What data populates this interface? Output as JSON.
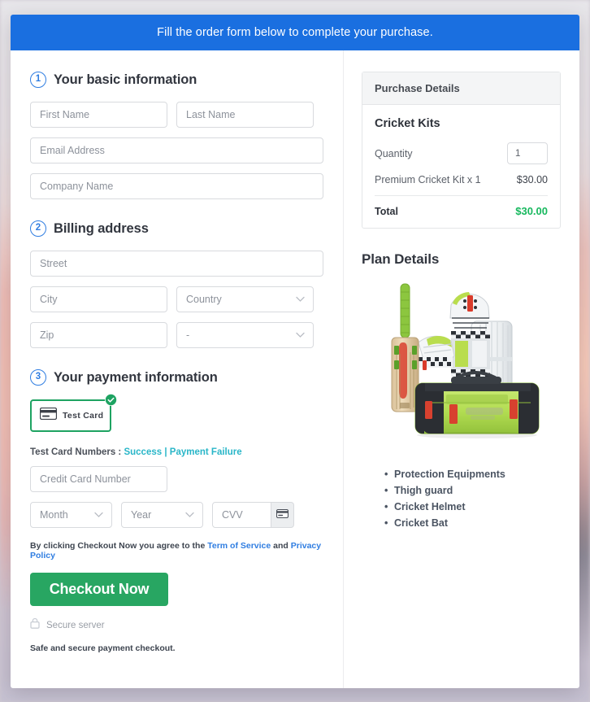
{
  "banner": {
    "message": "Fill the order form below to complete your purchase."
  },
  "basic_info": {
    "step": "1",
    "title": "Your basic information",
    "first_name_placeholder": "First Name",
    "last_name_placeholder": "Last Name",
    "email_placeholder": "Email Address",
    "company_placeholder": "Company Name"
  },
  "billing": {
    "step": "2",
    "title": "Billing address",
    "street_placeholder": "Street",
    "city_placeholder": "City",
    "country_value": "Country",
    "zip_placeholder": "Zip",
    "state_value": "-"
  },
  "payment": {
    "step": "3",
    "title": "Your payment information",
    "card_tile_label": "Test Card",
    "card_tile_icon": "credit-card-icon",
    "selected_badge_icon": "check-circle-icon",
    "test_numbers_label": "Test Card Numbers :",
    "test_success_link": "Success",
    "test_separator": "|",
    "test_failure_link": "Payment Failure",
    "card_number_placeholder": "Credit Card Number",
    "month_value": "Month",
    "year_value": "Year",
    "cvv_placeholder": "CVV",
    "cvv_icon": "credit-card-icon"
  },
  "agreement": {
    "prefix": "By clicking Checkout Now you agree to the",
    "terms_link": "Term of Service",
    "conjunction": "and",
    "privacy_link": "Privacy Policy"
  },
  "actions": {
    "checkout_label": "Checkout Now",
    "secure_icon": "lock-icon",
    "secure_label": "Secure server",
    "safe_note": "Safe and secure payment checkout."
  },
  "purchase_details": {
    "header": "Purchase Details",
    "plan_name": "Cricket Kits",
    "quantity_label": "Quantity",
    "quantity_value": "1",
    "line_item_label": "Premium Cricket Kit x 1",
    "line_item_price": "$30.00",
    "total_label": "Total",
    "total_value": "$30.00"
  },
  "plan_details": {
    "title": "Plan Details",
    "product_image_alt": "cricket-kit-photo",
    "features": [
      "Protection Equipments",
      "Thigh guard",
      "Cricket Helmet",
      "Cricket Bat"
    ]
  },
  "colors": {
    "banner_blue": "#1a6fe0",
    "accent_blue": "#2f7de1",
    "success_green": "#28a662",
    "total_green": "#17b85e",
    "link_teal": "#29b6c8",
    "tile_border_green": "#1ea362"
  }
}
